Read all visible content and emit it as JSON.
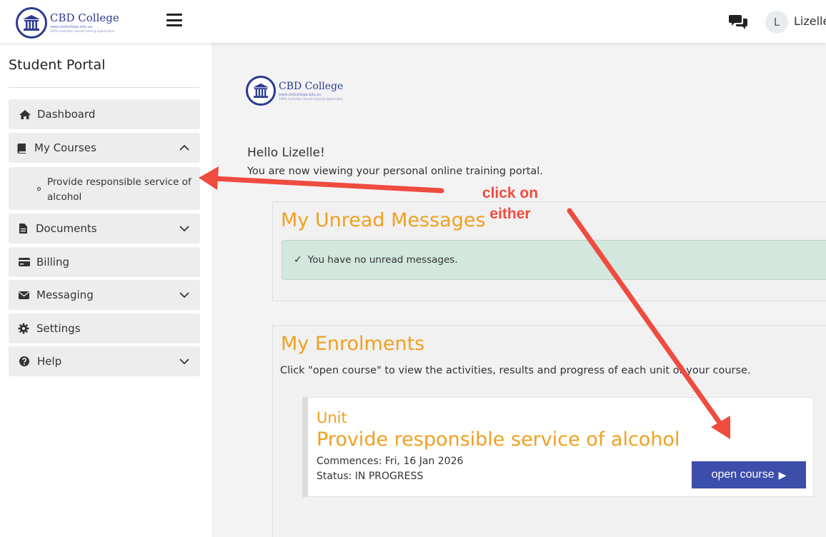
{
  "header": {
    "logo_name": "CBD College",
    "logo_url": "www.cbdcollege.edu.au",
    "logo_tagline": "100% Australian owned training organisation",
    "user_initial": "L",
    "user_name": "Lizelle"
  },
  "sidebar": {
    "title": "Student Portal",
    "items": [
      {
        "label": "Dashboard",
        "icon": "home-icon"
      },
      {
        "label": "My Courses",
        "icon": "book-icon",
        "expanded": true
      },
      {
        "label": "Documents",
        "icon": "file-icon"
      },
      {
        "label": "Billing",
        "icon": "credit-card-icon"
      },
      {
        "label": "Messaging",
        "icon": "envelope-icon"
      },
      {
        "label": "Settings",
        "icon": "gear-icon"
      },
      {
        "label": "Help",
        "icon": "question-circle-icon"
      }
    ],
    "sub_item": "Provide responsible service of alcohol"
  },
  "main": {
    "greeting": "Hello Lizelle!",
    "greeting_sub": "You are now viewing your personal online training portal.",
    "messages": {
      "title": "My Unread Messages",
      "status": "You have no unread messages."
    },
    "enrolments": {
      "title": "My Enrolments",
      "description": "Click \"open course\" to view the activities, results and progress of each unit of your course.",
      "unit": {
        "label": "Unit",
        "name": "Provide responsible service of alcohol",
        "commences": "Commences: Fri, 16 Jan 2026",
        "status": "Status: IN PROGRESS",
        "button": "open course"
      }
    }
  },
  "annotation": {
    "line1": "click on",
    "line2": "either",
    "color": "#ef4b3f"
  },
  "colors": {
    "accent": "#f0a020",
    "button": "#3d4eaa",
    "success_bg": "#d2e7dd",
    "brand": "#2b3a8f"
  }
}
